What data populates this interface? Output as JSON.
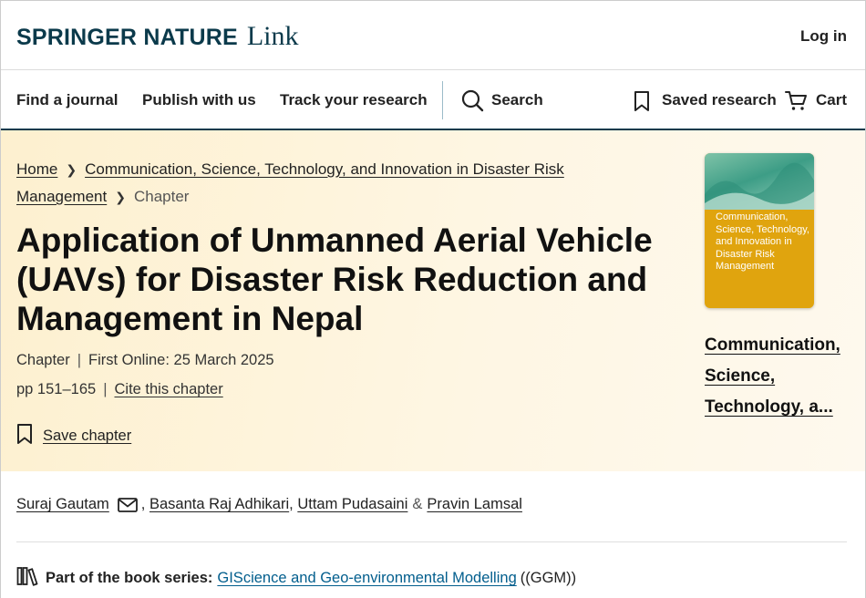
{
  "header": {
    "brand_main": "SPRINGER NATURE",
    "brand_sub": "Link",
    "login": "Log in"
  },
  "nav": {
    "find_journal": "Find a journal",
    "publish": "Publish with us",
    "track": "Track your research",
    "search": "Search",
    "saved": "Saved research",
    "cart": "Cart"
  },
  "breadcrumb": {
    "home": "Home",
    "book_line1": "Communication, Science, Technology, and Innovation in Disaster Risk",
    "book_line2": "Management",
    "current": "Chapter"
  },
  "chapter": {
    "title": "Application of Unmanned Aerial Vehicle (UAVs) for Disaster Risk Reduction and Management in Nepal",
    "type": "Chapter",
    "first_online": "First Online: 25 March 2025",
    "pages": "pp 151–165",
    "cite": "Cite this chapter",
    "save": "Save chapter"
  },
  "book": {
    "cover_title": "Communication, Science, Technology, and Innovation in Disaster Risk Management",
    "link_title": "Communication, Science, Technology, a..."
  },
  "authors": {
    "a1": "Suraj Gautam",
    "a2": "Basanta Raj Adhikari",
    "a3": "Uttam Pudasaini",
    "amp": "&",
    "a4": "Pravin Lamsal"
  },
  "series": {
    "label": "Part of the book series:",
    "name": "GIScience and Geo-environmental Modelling",
    "abbr": "((GGM))"
  },
  "colors": {
    "brand": "#0b3a4b",
    "link": "#025e8d",
    "hero_bg": "#fdf0cf"
  }
}
